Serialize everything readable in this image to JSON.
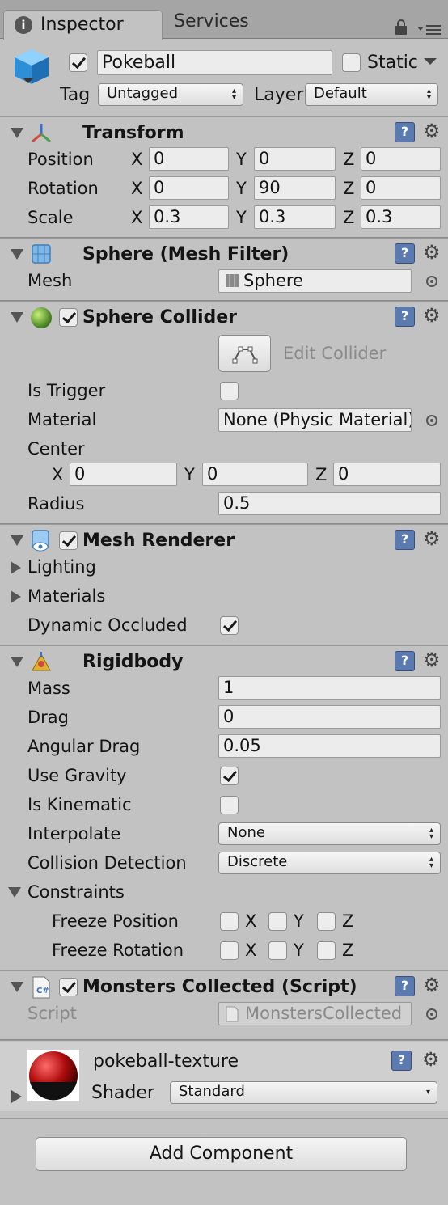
{
  "tabs": {
    "inspector": "Inspector",
    "services": "Services"
  },
  "object": {
    "name": "Pokeball",
    "active": true,
    "static_label": "Static",
    "static": false,
    "tag_label": "Tag",
    "tag": "Untagged",
    "layer_label": "Layer",
    "layer": "Default"
  },
  "transform": {
    "title": "Transform",
    "rows": [
      {
        "label": "Position",
        "x": "0",
        "y": "0",
        "z": "0"
      },
      {
        "label": "Rotation",
        "x": "0",
        "y": "90",
        "z": "0"
      },
      {
        "label": "Scale",
        "x": "0.3",
        "y": "0.3",
        "z": "0.3"
      }
    ],
    "axis": {
      "x": "X",
      "y": "Y",
      "z": "Z"
    }
  },
  "mesh_filter": {
    "title": "Sphere (Mesh Filter)",
    "mesh_label": "Mesh",
    "mesh": "Sphere"
  },
  "sphere_collider": {
    "title": "Sphere Collider",
    "enabled": true,
    "edit_label": "Edit Collider",
    "is_trigger_label": "Is Trigger",
    "is_trigger": false,
    "material_label": "Material",
    "material": "None (Physic Material)",
    "center_label": "Center",
    "cx": "0",
    "cy": "0",
    "cz": "0",
    "radius_label": "Radius",
    "radius": "0.5"
  },
  "mesh_renderer": {
    "title": "Mesh Renderer",
    "enabled": true,
    "lighting": "Lighting",
    "materials": "Materials",
    "dynamic_occluded_label": "Dynamic Occluded",
    "dynamic_occluded": true
  },
  "rigidbody": {
    "title": "Rigidbody",
    "mass_label": "Mass",
    "mass": "1",
    "drag_label": "Drag",
    "drag": "0",
    "angular_drag_label": "Angular Drag",
    "angular_drag": "0.05",
    "use_gravity_label": "Use Gravity",
    "use_gravity": true,
    "is_kinematic_label": "Is Kinematic",
    "is_kinematic": false,
    "interpolate_label": "Interpolate",
    "interpolate": "None",
    "collision_label": "Collision Detection",
    "collision": "Discrete",
    "constraints_label": "Constraints",
    "freeze_position_label": "Freeze Position",
    "freeze_rotation_label": "Freeze Rotation"
  },
  "script": {
    "title": "Monsters Collected (Script)",
    "enabled": true,
    "script_label": "Script",
    "script": "MonstersCollected"
  },
  "material": {
    "name": "pokeball-texture",
    "shader_label": "Shader",
    "shader": "Standard"
  },
  "add_component": "Add Component",
  "colors": {
    "background": "#c2c2c2",
    "tabbar": "#a5a5a5",
    "field": "#ececec",
    "help_icon": "#5a7ab0"
  }
}
